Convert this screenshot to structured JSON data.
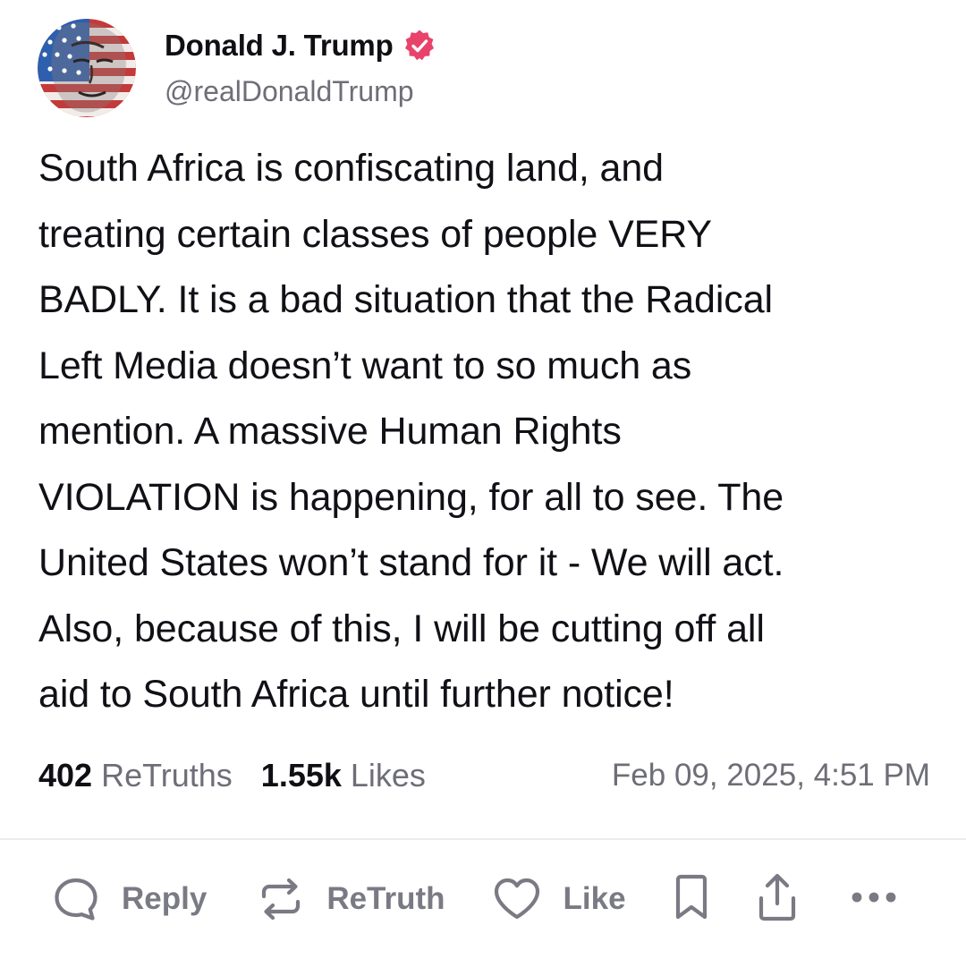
{
  "author": {
    "display_name": "Donald J. Trump",
    "handle": "@realDonaldTrump",
    "verified": true,
    "verified_color": "#e8436a"
  },
  "post": {
    "text": "South Africa is confiscating land, and\ntreating certain classes of people VERY\nBADLY. It is a bad situation that the Radical\nLeft Media doesn’t want to so much as\nmention. A massive Human Rights\nVIOLATION is happening, for all to see. The\nUnited States won’t stand for it - We will act.\nAlso, because of this, I will be cutting off all\naid to South Africa until further notice!"
  },
  "stats": {
    "retruths_count": "402",
    "retruths_label": "ReTruths",
    "likes_count": "1.55k",
    "likes_label": "Likes",
    "timestamp": "Feb 09, 2025, 4:51 PM"
  },
  "actions": {
    "reply_label": "Reply",
    "retruth_label": "ReTruth",
    "like_label": "Like",
    "icons": [
      "reply-icon",
      "retruth-icon",
      "heart-icon",
      "bookmark-icon",
      "share-icon",
      "more-icon"
    ]
  },
  "colors": {
    "text": "#0f0f14",
    "muted": "#6e6e78",
    "action": "#7a7a84",
    "divider": "#ececf0"
  }
}
